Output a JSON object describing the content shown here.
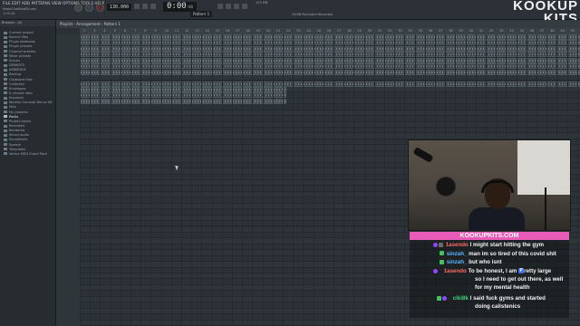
{
  "topbar": {
    "menu_text": "FILE  EDIT  ADD  PATTERNS  VIEW  OPTIONS  TOOLS  HELP",
    "project_name": "NewsClubBeatDrums",
    "project_time": "1:00:08",
    "bpm": "130.000",
    "song_position": "0:00",
    "song_position_sub": ":00",
    "pattern_label": "Pattern 1",
    "cpu_info": "103 MB",
    "hint_text": "09/08  Recorded Recorded"
  },
  "logo": {
    "line1": "KOOKUP",
    "line2": "KITS"
  },
  "browser": {
    "header": "Browser - All",
    "items": [
      {
        "label": "Current project"
      },
      {
        "label": "Recent files"
      },
      {
        "label": "Plugin database"
      },
      {
        "label": "Plugin presets"
      },
      {
        "label": "Channel presets"
      },
      {
        "label": "Mixer presets"
      },
      {
        "label": "Scores"
      },
      {
        "label": "DEMIKITS"
      },
      {
        "label": "AMBIENCE"
      },
      {
        "label": "Backup"
      },
      {
        "label": "Clipboard files"
      },
      {
        "label": "Collected"
      },
      {
        "label": "Envelopes"
      },
      {
        "label": "IL shared data"
      },
      {
        "label": "Impulses"
      },
      {
        "label": "KookUp Concept Bonus Kit"
      },
      {
        "label": "Misc"
      },
      {
        "label": "My projects"
      },
      {
        "label": "Packs"
      },
      {
        "label": "Project bones"
      },
      {
        "label": "Recorded"
      },
      {
        "label": "Rendered"
      },
      {
        "label": "Sliced audio"
      },
      {
        "label": "Soundfonts"
      },
      {
        "label": "Speech"
      },
      {
        "label": "Templates"
      },
      {
        "label": "Vorton MIDI Chord Pack"
      }
    ]
  },
  "playlist": {
    "title": "Playlist - Arrangement › Pattern 1",
    "ruler_ticks": [
      "2",
      "3",
      "4",
      "5",
      "6",
      "7",
      "8",
      "9",
      "10",
      "11",
      "12",
      "13",
      "14",
      "15",
      "16",
      "17",
      "18",
      "19",
      "20",
      "21",
      "22",
      "23",
      "24",
      "25",
      "26",
      "27",
      "28",
      "29",
      "30",
      "31",
      "32",
      "33",
      "34",
      "35",
      "36",
      "37",
      "38",
      "39",
      "40",
      "41",
      "42",
      "43",
      "44",
      "45",
      "46",
      "47",
      "48",
      "49",
      "50"
    ]
  },
  "chat": {
    "banner": "KOOKUPKITS.COM",
    "messages": [
      {
        "user": "1asendo",
        "color": "#ff5a5a",
        "text": "I might start hitting the gym",
        "cont": ""
      },
      {
        "user": "sinzah_",
        "color": "#5ab4ff",
        "text": "man im so tired of this covid shit",
        "cont": ""
      },
      {
        "user": "sinzah_",
        "color": "#5ab4ff",
        "text": "but who isnt",
        "cont": ""
      },
      {
        "user": "1asendo",
        "color": "#ff5a5a",
        "text": "To be honest, I am",
        "text2": "retty large",
        "cont1": "so I need to get out there, as well",
        "cont2": "for my mental health"
      },
      {
        "user": "clki8k",
        "color": "#3fd17a",
        "text": "I said fuck gyms and started",
        "cont": "doing calistenics"
      }
    ],
    "emote_letter": "P",
    "colors": {
      "banner": "#e85bb8"
    }
  }
}
